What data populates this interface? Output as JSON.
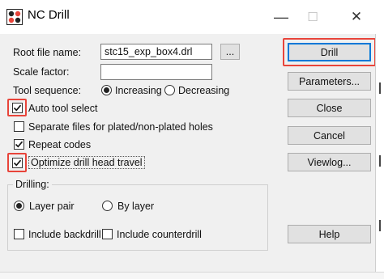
{
  "window": {
    "title": "NC Drill",
    "minimize_glyph": "—",
    "maximize_glyph": "☐",
    "close_glyph": "✕",
    "icon": "nc-drill-app-icon"
  },
  "form": {
    "root_file_label": "Root file name:",
    "root_file_value": "stc15_exp_box4.drl",
    "browse_label": "...",
    "scale_label": "Scale factor:",
    "scale_value": "",
    "tool_sequence_label": "Tool sequence:",
    "increasing_label": "Increasing",
    "decreasing_label": "Decreasing",
    "tool_sequence_selected": "Increasing"
  },
  "options": {
    "auto_tool_select": {
      "label": "Auto tool select",
      "checked": true
    },
    "separate_files": {
      "label": "Separate files for plated/non-plated holes",
      "checked": false
    },
    "repeat_codes": {
      "label": "Repeat codes",
      "checked": true
    },
    "optimize_drill": {
      "label": "Optimize drill head travel",
      "checked": true
    }
  },
  "drilling": {
    "title": "Drilling:",
    "layer_pair_label": "Layer pair",
    "by_layer_label": "By layer",
    "selected": "Layer pair",
    "include_backdrill_label": "Include backdrill",
    "include_counterdrill_label": "Include counterdrill"
  },
  "buttons": {
    "drill": "Drill",
    "parameters": "Parameters...",
    "close": "Close",
    "cancel": "Cancel",
    "viewlog": "Viewlog...",
    "help": "Help"
  },
  "colors": {
    "highlight_red": "#e8443a",
    "default_button_border": "#0078d7"
  }
}
